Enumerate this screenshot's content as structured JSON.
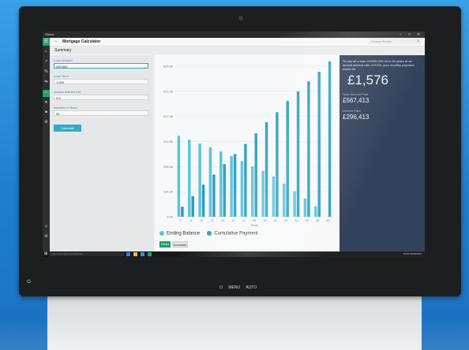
{
  "window": {
    "app_title": "Stress",
    "min": "–",
    "max": "□",
    "close": "✕"
  },
  "header": {
    "back_icon": "←",
    "title": "Mortgage Calculator",
    "search_placeholder": "Search Stocks"
  },
  "summary": {
    "label": "Summary"
  },
  "form": {
    "loan_amount_label": "Loan Amount",
    "loan_amount_value": "200,000",
    "loan_term_label": "Loan Term",
    "loan_term_value": "1.000",
    "interest_label": "Annual Interest (%)",
    "interest_value": "5.5",
    "years_label": "Number of Years",
    "years_value": "30",
    "calculate_label": "Calculate"
  },
  "results": {
    "intro": "To pay off a loan of £200,000.00 in 30 years at an annual interest rate of 5.5%, your monthly payment would be:",
    "monthly": "£1,576",
    "total_label": "Total Amount Paid",
    "total_value": "£567,413",
    "interest_label": "Interest Paid",
    "interest_value": "£296,413"
  },
  "chart_toggle": {
    "chart_label": "Chart",
    "schedule_label": "Schedule"
  },
  "taskbar": {
    "search_text": "Search the web and Windows",
    "time": "15:45",
    "date": "16/06/2015"
  },
  "bezel": {
    "menu": "MENU",
    "auto": "AUTO"
  },
  "colors": {
    "ending_balance": "#5bc4dd",
    "cumulative_payment": "#2b9fbf",
    "accent": "#21a366",
    "result_bg": "#2c3b55"
  },
  "chart_data": {
    "type": "bar",
    "xlabel": "Years",
    "ylabel": "",
    "categories": [
      2,
      4,
      6,
      8,
      10,
      12,
      14,
      16,
      18,
      20,
      22,
      24,
      26,
      28,
      30
    ],
    "ylim": [
      0,
      600000
    ],
    "y_ticks": [
      "0.00",
      "104.2k",
      "208.5k",
      "312.8k",
      "417.0k",
      "511.3k",
      "625.6k"
    ],
    "series": [
      {
        "name": "Ending Balance",
        "color": "#5bc4dd",
        "values": [
          323000,
          307000,
          291000,
          277000,
          261000,
          242000,
          222000,
          201000,
          183000,
          161000,
          133000,
          102000,
          73000,
          42000,
          0
        ]
      },
      {
        "name": "Cumulative Payment",
        "color": "#2b9fbf",
        "values": [
          40000,
          82000,
          128000,
          168000,
          210000,
          250000,
          290000,
          333000,
          377000,
          417000,
          462000,
          500000,
          540000,
          578000,
          619000
        ]
      }
    ]
  }
}
